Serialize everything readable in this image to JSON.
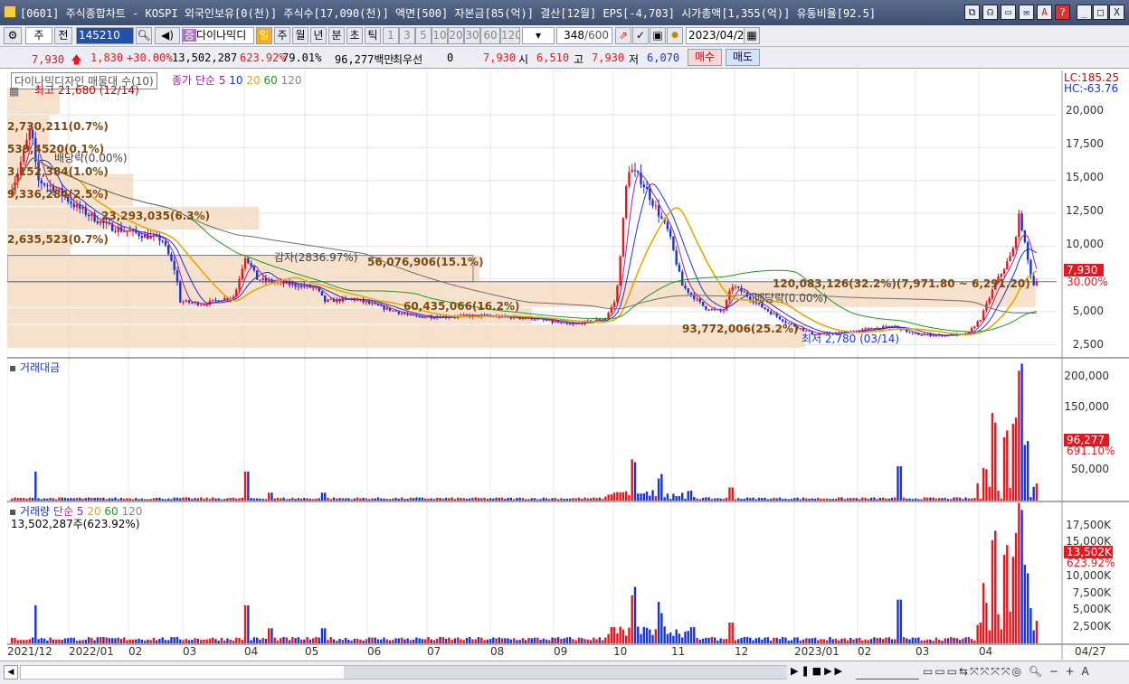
{
  "window": {
    "title": "[0601] 주식종합차트 - KOSPI 외국인보유[0(천)] 주식수[17,090(천)] 액면[500] 자본금[85(억)] 결산[12월] EPS[-4,703] 시가총액[1,355(억)] 유통비율[92.5]",
    "buttons": [
      "⧉",
      "☊",
      "▭",
      "✉",
      "A",
      "?",
      "_",
      "□",
      "X"
    ]
  },
  "toolbar1": {
    "type": "주",
    "prev": "전",
    "code": "145210",
    "name": "다이나믹디",
    "periods": [
      "일",
      "주",
      "월",
      "년",
      "분",
      "초",
      "틱"
    ],
    "minutes": [
      "1",
      "3",
      "5",
      "10",
      "20",
      "30",
      "60",
      "120"
    ],
    "count": "348",
    "count_total": "/600",
    "date": "2023/04/27"
  },
  "quote": {
    "price": "7,930",
    "change": "1,830",
    "pct": "+30.00%",
    "volume": "13,502,287",
    "vol_ratio": "623.92%",
    "rate": "79.01%",
    "amount": "96,277백만",
    "pref": "최우선",
    "pref_val": "0",
    "bid": "7,930",
    "open_label": "시",
    "open": "6,510",
    "high_label": "고",
    "high": "7,930",
    "low_label": "저",
    "low": "6,070",
    "buy": "매수",
    "sell": "매도"
  },
  "price_panel": {
    "legend_name": "다이나믹디자인 매물대 수(10)",
    "legend_ma": "종가 단순",
    "ma": [
      "5",
      "10",
      "20",
      "60",
      "120"
    ],
    "lc": "LC:185.25",
    "hc": "HC:-63.76",
    "high": "최고 21,680 (12/14)",
    "low": "최저 2,780 (03/14)",
    "capred": "감자(2836.97%)",
    "div1": "배당락(0.00%)",
    "div2": "배당락(0.00%)",
    "cur": "7,930",
    "cur_pct": "30.00%",
    "profile": [
      "2,730,211(0.7%)",
      "539,4520(0.1%)",
      "3,152,384(1.0%)",
      "9,336,284(2.5%)",
      "23,293,035(6.3%)",
      "2,635,523(0.7%)",
      "56,076,906(15.1%)",
      "120,083,126(32.2%)(7,971.80 ~ 6,291.20)",
      "60,435,066(16.2%)",
      "93,772,006(25.2%)"
    ],
    "yticks": [
      "20,000",
      "17,500",
      "15,000",
      "12,500",
      "10,000",
      "7,500",
      "5,000",
      "2,500"
    ]
  },
  "amount_panel": {
    "title": "거래대금",
    "cur": "96,277",
    "cur_pct": "691.10%",
    "yticks": [
      "200,000",
      "150,000",
      "50,000"
    ]
  },
  "vol_panel": {
    "title": "거래량",
    "legend": "단순",
    "ma": [
      "5",
      "20",
      "60",
      "120"
    ],
    "info": "13,502,287주(623.92%)",
    "cur": "13,502K",
    "cur_pct": "623.92%",
    "yticks": [
      "17,500K",
      "15,000K",
      "12,500K",
      "10,000K",
      "7,500K",
      "5,000K",
      "2,500K"
    ]
  },
  "xaxis": [
    "2021/12",
    "2022/01",
    "02",
    "03",
    "04",
    "05",
    "06",
    "07",
    "08",
    "09",
    "10",
    "11",
    "12",
    "2023/01",
    "02",
    "03",
    "04",
    "04/27"
  ],
  "chart_data": {
    "type": "candlestick",
    "symbol": "다이나믹디자인",
    "code": "145210",
    "high": {
      "value": 21680,
      "date": "12/14"
    },
    "low": {
      "value": 2780,
      "date": "03/14"
    },
    "last": 7930,
    "change_pct": 30.0,
    "ylim": [
      1500,
      22000
    ]
  },
  "colors": {
    "up": "#e8161e",
    "down": "#1a33d6",
    "ma5": "#a31fa3",
    "ma10": "#1a33d6",
    "ma20": "#e8a800",
    "ma60": "#1c9b1c",
    "ma120": "#6e6e6e",
    "profile": "#f5dcc4"
  }
}
